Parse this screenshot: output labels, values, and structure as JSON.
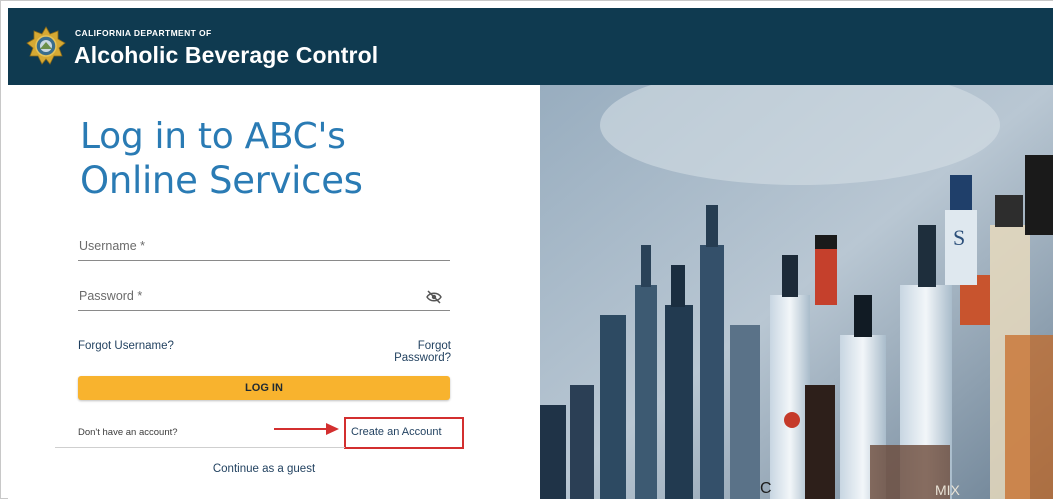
{
  "header": {
    "dept_small": "CALIFORNIA DEPARTMENT OF",
    "dept_large": "Alcoholic Beverage Control",
    "seal_icon": "california-seal-icon"
  },
  "login": {
    "title_line1": "Log in to ABC's",
    "title_line2": "Online Services",
    "username_label": "Username *",
    "password_label": "Password *",
    "forgot_username": "Forgot Username?",
    "forgot_password": "Forgot Password?",
    "login_button": "LOG IN",
    "no_account": "Don't have an account?",
    "create_account": "Create an Account",
    "guest": "Continue as a guest"
  },
  "colors": {
    "header_bg": "#0f3a50",
    "title_blue": "#2a7bb4",
    "button_yellow": "#f8b32e",
    "highlight_red": "#d32f2f"
  }
}
